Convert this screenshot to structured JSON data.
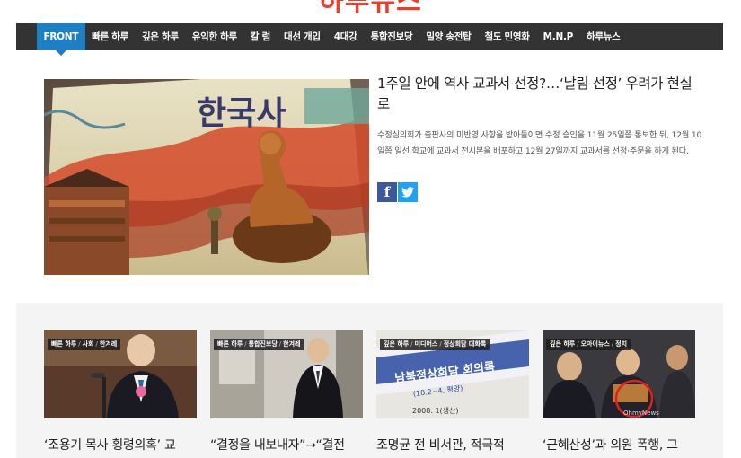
{
  "site": {
    "logo": "하루뉴스"
  },
  "nav": {
    "items": [
      {
        "label": "FRONT",
        "active": true
      },
      {
        "label": "빠른 하루"
      },
      {
        "label": "깊은 하루"
      },
      {
        "label": "유익한 하루"
      },
      {
        "label": "칼 럼"
      },
      {
        "label": "대선 개입"
      },
      {
        "label": "4대강"
      },
      {
        "label": "통합진보당"
      },
      {
        "label": "밀양 송전탑"
      },
      {
        "label": "철도 민영화"
      },
      {
        "label": "M.N.P"
      },
      {
        "label": "하루뉴스"
      }
    ]
  },
  "featured": {
    "title": "1주일 안에 역사 교과서 선정?…‘날림 선정’ 우려가 현실로",
    "summary": "수정심의회가 출판사의 미반영 사항을 받아들이면 수정 승인을 11월 25일쯤 통보한 뒤, 12월 10일쯤 일선 학교에 교과서 전시본을 배포하고 12월 27일까지 교과서를 선정·주문을 하게 된다.",
    "book_text": "한국사",
    "share": {
      "facebook": "f",
      "twitter": "t"
    }
  },
  "cards": [
    {
      "categories": [
        "빠른 하루",
        "사회",
        "한겨레"
      ],
      "title": "‘조용기 목사 횡령의혹’ 교"
    },
    {
      "categories": [
        "빠른 하루",
        "통합진보당",
        "한겨레"
      ],
      "title": "“결정을 내보내자”→“결전"
    },
    {
      "categories": [
        "깊은 하루",
        "미디어스",
        "정상회담 대화록"
      ],
      "title": "조명균 전 비서관, 적극적",
      "image_text": "남북정상회담 회의록",
      "image_subtext": "(10.2~4, 평양)",
      "image_date": "2008. 1(생산)"
    },
    {
      "categories": [
        "깊은 하루",
        "오마이뉴스",
        "정치"
      ],
      "title": "‘근혜산성’과 의원 폭행, 그",
      "image_text": "OhmyNews"
    }
  ]
}
